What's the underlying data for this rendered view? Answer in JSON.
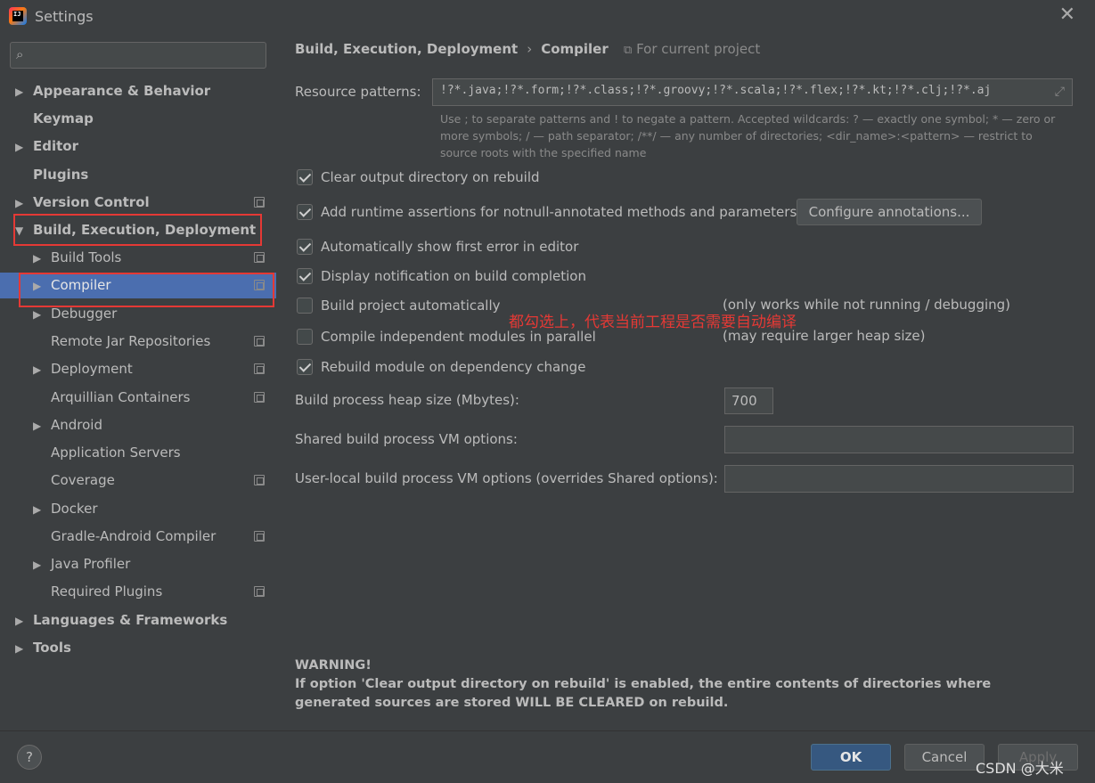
{
  "window": {
    "title": "Settings",
    "app_icon": "intellij-idea-icon",
    "close_icon": "close-icon",
    "close_glyph": "✕"
  },
  "search": {
    "placeholder": "",
    "icon": "search-icon"
  },
  "sidebar": {
    "items": [
      {
        "label": "Appearance & Behavior",
        "expandable": true,
        "expanded": false
      },
      {
        "label": "Keymap"
      },
      {
        "label": "Editor",
        "expandable": true
      },
      {
        "label": "Plugins"
      },
      {
        "label": "Version Control",
        "expandable": true,
        "project_scope": true
      },
      {
        "label": "Build, Execution, Deployment",
        "expandable": true,
        "expanded": true
      },
      {
        "label": "Build Tools",
        "expandable": true,
        "project_scope": true
      },
      {
        "label": "Compiler",
        "expandable": true,
        "selected": true,
        "project_scope": true
      },
      {
        "label": "Debugger",
        "expandable": true
      },
      {
        "label": "Remote Jar Repositories",
        "project_scope": true
      },
      {
        "label": "Deployment",
        "expandable": true,
        "project_scope": true
      },
      {
        "label": "Arquillian Containers",
        "project_scope": true
      },
      {
        "label": "Android",
        "expandable": true
      },
      {
        "label": "Application Servers"
      },
      {
        "label": "Coverage",
        "project_scope": true
      },
      {
        "label": "Docker",
        "expandable": true
      },
      {
        "label": "Gradle-Android Compiler",
        "project_scope": true
      },
      {
        "label": "Java Profiler",
        "expandable": true
      },
      {
        "label": "Required Plugins",
        "project_scope": true
      },
      {
        "label": "Languages & Frameworks",
        "expandable": true
      },
      {
        "label": "Tools",
        "expandable": true
      }
    ]
  },
  "breadcrumb": {
    "parent": "Build, Execution, Deployment",
    "separator": "›",
    "current": "Compiler",
    "scope": "For current project"
  },
  "resource_patterns": {
    "label": "Resource patterns:",
    "value": "!?*.java;!?*.form;!?*.class;!?*.groovy;!?*.scala;!?*.flex;!?*.kt;!?*.clj;!?*.aj",
    "hint": "Use ; to separate patterns and ! to negate a pattern. Accepted wildcards: ? — exactly one symbol; * — zero or more symbols; / — path separator; /**/ — any number of directories; <dir_name>:<pattern> — restrict to source roots with the specified name"
  },
  "options": {
    "clear_output": {
      "label": "Clear output directory on rebuild",
      "checked": true
    },
    "runtime_assertions": {
      "label": "Add runtime assertions for notnull-annotated methods and parameters",
      "checked": true
    },
    "configure_annotations": "Configure annotations...",
    "show_first_error": {
      "label": "Automatically show first error in editor",
      "checked": true
    },
    "display_notification": {
      "label": "Display notification on build completion",
      "checked": true
    },
    "build_automatically": {
      "label": "Build project automatically",
      "checked": false,
      "note": "(only works while not running / debugging)"
    },
    "compile_parallel": {
      "label": "Compile independent modules in parallel",
      "checked": false,
      "note": "(may require larger heap size)"
    },
    "rebuild_on_dependency": {
      "label": "Rebuild module on dependency change",
      "checked": true
    }
  },
  "heap": {
    "label": "Build process heap size (Mbytes):",
    "value": "700"
  },
  "shared_vm": {
    "label": "Shared build process VM options:",
    "value": ""
  },
  "user_vm": {
    "label": "User-local build process VM options (overrides Shared options):",
    "value": ""
  },
  "annotation_text": "都勾选上，代表当前工程是否需要自动编译",
  "warning": {
    "title": "WARNING!",
    "body": "If option 'Clear output directory on rebuild' is enabled, the entire contents of directories where generated sources are stored WILL BE CLEARED on rebuild."
  },
  "footer": {
    "help": "?",
    "ok": "OK",
    "cancel": "Cancel",
    "apply": "Apply",
    "watermark": "CSDN @大米"
  },
  "colors": {
    "background": "#3c3f41",
    "selection": "#4b6eaf",
    "annotation_red": "#e53935",
    "primary_button": "#365880"
  }
}
